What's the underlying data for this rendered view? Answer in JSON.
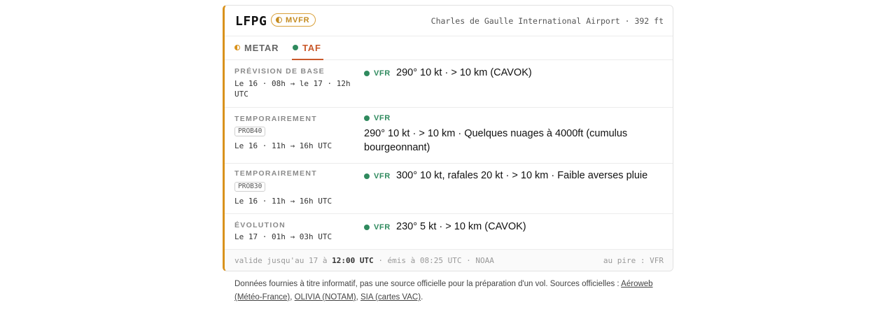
{
  "header": {
    "icao": "LFPG",
    "flight_category": "MVFR",
    "airport": "Charles de Gaulle International Airport · 392 ft",
    "colors": {
      "accent": "#d9921c",
      "vfr": "#2f8a5e",
      "taf": "#c9582a"
    }
  },
  "tabs": [
    {
      "label": "METAR",
      "icon": "half-circle-icon",
      "active": false
    },
    {
      "label": "TAF",
      "icon": "green-dot-icon",
      "active": true
    }
  ],
  "forecasts": [
    {
      "kind": "PRÉVISION DE BASE",
      "prob": "",
      "period": "Le 16 · 08h → le 17 · 12h UTC",
      "category": "VFR",
      "description": "290° 10 kt · > 10 km (CAVOK)"
    },
    {
      "kind": "TEMPORAIREMENT",
      "prob": "PROB40",
      "period": "Le 16 · 11h → 16h UTC",
      "category": "VFR",
      "description": "290° 10 kt · > 10 km · Quelques nuages à 4000ft (cumulus bourgeonnant)"
    },
    {
      "kind": "TEMPORAIREMENT",
      "prob": "PROB30",
      "period": "Le 16 · 11h → 16h UTC",
      "category": "VFR",
      "description": "300° 10 kt, rafales 20 kt · > 10 km · Faible averses pluie"
    },
    {
      "kind": "ÉVOLUTION",
      "prob": "",
      "period": "Le 17 · 01h → 03h UTC",
      "category": "VFR",
      "description": "230° 5 kt · > 10 km (CAVOK)"
    }
  ],
  "footer": {
    "valid_prefix": "valide jusqu'au 17 à",
    "valid_time": "12:00 UTC",
    "issued": "· émis à 08:25 UTC · NOAA",
    "worst": "au pire : VFR"
  },
  "disclaimer": {
    "text": "Données fournies à titre informatif, pas une source officielle pour la préparation d'un vol. Sources officielles : ",
    "links": [
      "Aéroweb (Météo-France)",
      "OLIVIA (NOTAM)",
      "SIA (cartes VAC)"
    ],
    "sep": ", ",
    "end": "."
  }
}
